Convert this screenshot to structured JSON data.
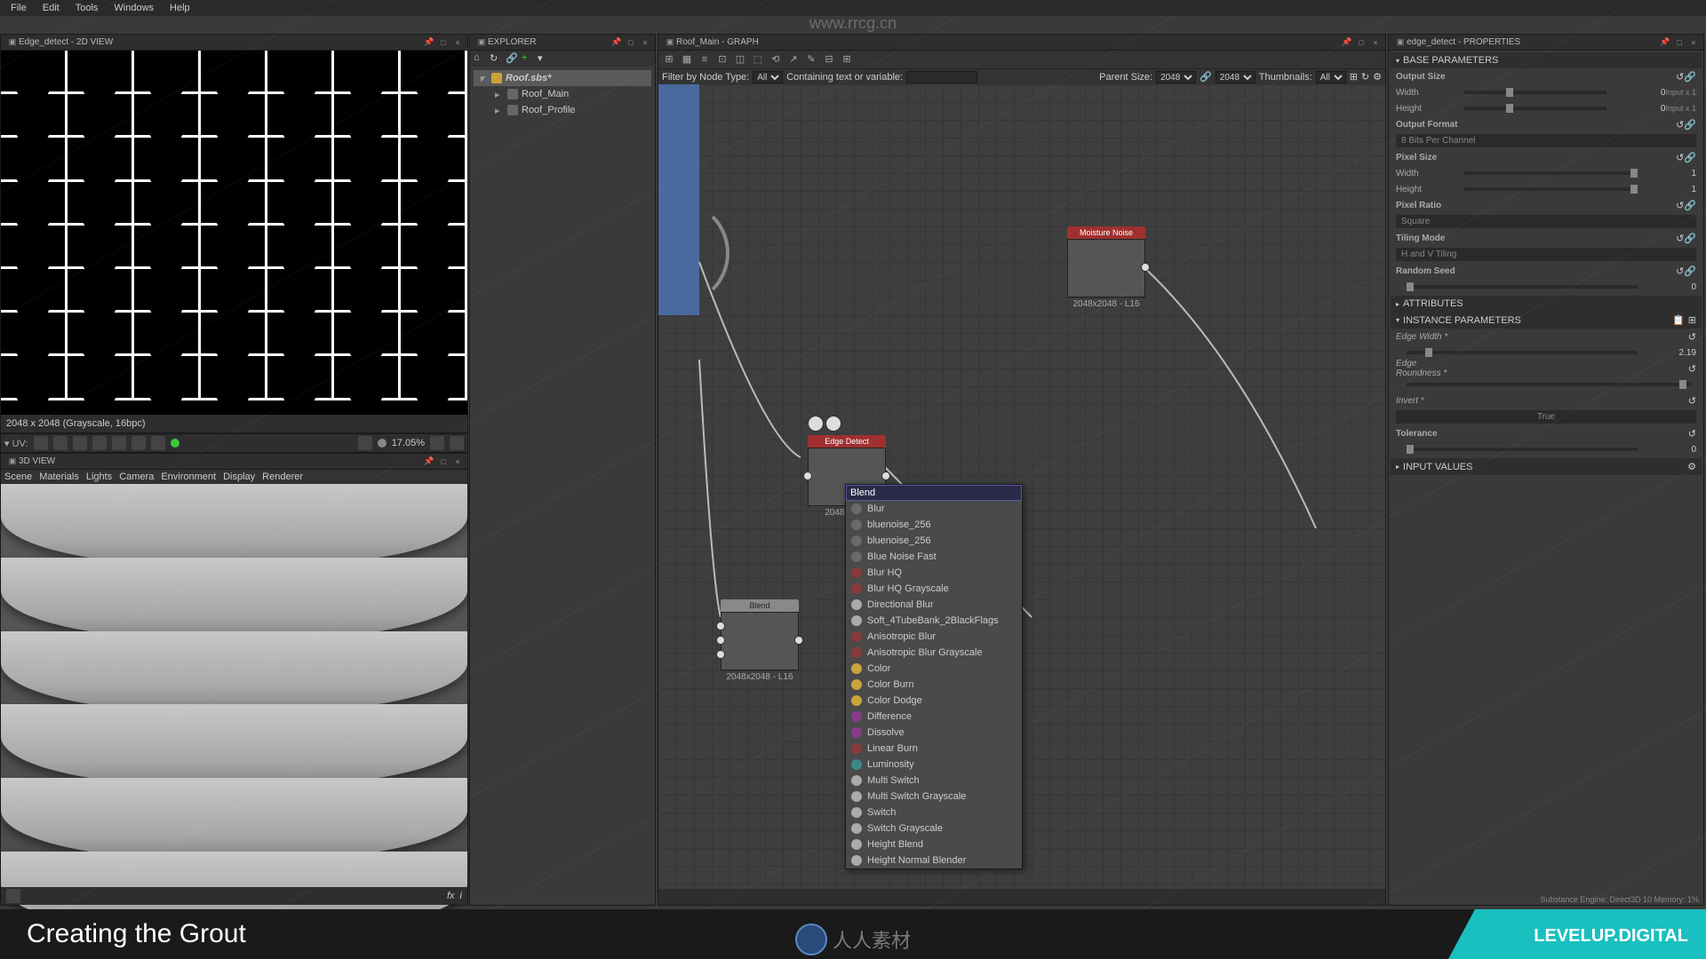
{
  "menubar": [
    "File",
    "Edit",
    "Tools",
    "Windows",
    "Help"
  ],
  "watermark": "www.rrcg.cn",
  "panels": {
    "view2d": {
      "title": "Edge_detect - 2D VIEW",
      "status": "2048 x 2048 (Grayscale, 16bpc)",
      "zoom": "17.05%"
    },
    "view3d": {
      "title": "3D VIEW",
      "sub": [
        "Scene",
        "Materials",
        "Lights",
        "Camera",
        "Environment",
        "Display",
        "Renderer"
      ]
    },
    "explorer": {
      "title": "EXPLORER",
      "root": "Roof.sbs*",
      "items": [
        "Roof_Main",
        "Roof_Profile"
      ]
    },
    "graph": {
      "title": "Roof_Main - GRAPH",
      "filterLabel": "Filter by Node Type:",
      "filterVal": "All",
      "containLabel": "Containing text or variable:",
      "containVal": "",
      "parentLabel": "Parent Size:",
      "parentVal": "2048",
      "thumbLabel": "Thumbnails:",
      "thumbVal": "All",
      "nodes": {
        "moisture": {
          "label": "Moisture Noise",
          "res": "2048x2048 - L16"
        },
        "edge": {
          "label": "Edge Detect",
          "res": "2048x2048"
        },
        "blend": {
          "label": "Blend",
          "res": "2048x2048 - L16"
        }
      },
      "contextSearch": "Blend",
      "contextItems": [
        {
          "t": "Blur",
          "c": "#6a6a6a"
        },
        {
          "t": "bluenoise_256",
          "c": "#6a6a6a"
        },
        {
          "t": "bluenoise_256",
          "c": "#6a6a6a"
        },
        {
          "t": "Blue Noise Fast",
          "c": "#6a6a6a"
        },
        {
          "t": "Blur HQ",
          "c": "#8a3a3a"
        },
        {
          "t": "Blur HQ Grayscale",
          "c": "#8a3a3a"
        },
        {
          "t": "Directional Blur",
          "c": "#aaa"
        },
        {
          "t": "Soft_4TubeBank_2BlackFlags",
          "c": "#aaa"
        },
        {
          "t": "Anisotropic Blur",
          "c": "#8a3a3a"
        },
        {
          "t": "Anisotropic Blur Grayscale",
          "c": "#8a3a3a"
        },
        {
          "t": "Color",
          "c": "#caa23a"
        },
        {
          "t": "Color Burn",
          "c": "#caa23a"
        },
        {
          "t": "Color Dodge",
          "c": "#caa23a"
        },
        {
          "t": "Difference",
          "c": "#8a3a8a"
        },
        {
          "t": "Dissolve",
          "c": "#8a3a8a"
        },
        {
          "t": "Linear Burn",
          "c": "#8a3a3a"
        },
        {
          "t": "Luminosity",
          "c": "#3a8a8a"
        },
        {
          "t": "Multi Switch",
          "c": "#aaa"
        },
        {
          "t": "Multi Switch Grayscale",
          "c": "#aaa"
        },
        {
          "t": "Switch",
          "c": "#aaa"
        },
        {
          "t": "Switch Grayscale",
          "c": "#aaa"
        },
        {
          "t": "Height Blend",
          "c": "#aaa"
        },
        {
          "t": "Height Normal Blender",
          "c": "#aaa"
        }
      ]
    },
    "props": {
      "title": "edge_detect - PROPERTIES",
      "sections": {
        "base": "BASE PARAMETERS",
        "attrs": "ATTRIBUTES",
        "inst": "INSTANCE PARAMETERS",
        "inputVals": "INPUT VALUES"
      },
      "outputSize": "Output Size",
      "width": "Width",
      "height": "Height",
      "outputFormat": "Output Format",
      "outputFormatVal": "8 Bits Per Channel",
      "pixelSize": "Pixel Size",
      "pixelRatio": "Pixel Ratio",
      "pixelRatioVal": "Square",
      "tilingMode": "Tiling Mode",
      "tilingVal": "H and V Tiling",
      "randomSeed": "Random Seed",
      "seedVal": "0",
      "edgeWidth": "Edge Width *",
      "edgeWidthVal": "2.19",
      "edgeRound": "Edge Roundness *",
      "invert": "Invert *",
      "invertVal": "True",
      "tolerance": "Tolerance",
      "sizeVal0": "0",
      "sizeTag": "Input x 1",
      "sizeVal1": "1"
    }
  },
  "engineStatus": "Substance Engine: Direct3D 10   Memory: 1%",
  "caption": "Creating the Grout",
  "brand": "LEVELUP.DIGITAL",
  "midLogo": "人人素材"
}
